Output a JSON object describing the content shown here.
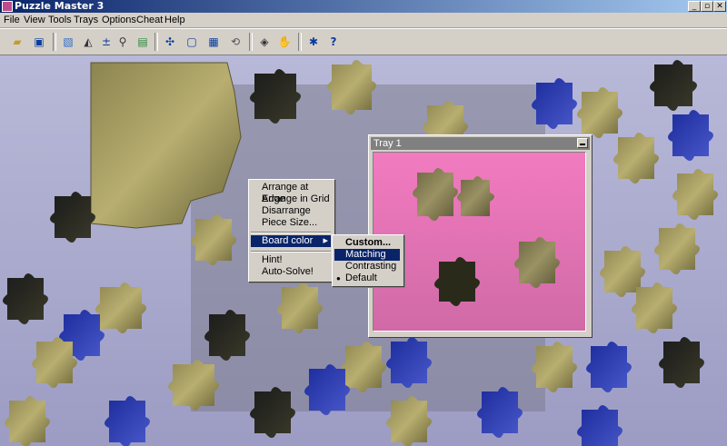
{
  "window": {
    "title": "Puzzle Master 3",
    "minimize_glyph": "_",
    "restore_glyph": "▫",
    "close_glyph": "✕"
  },
  "menubar": [
    "File",
    "View",
    "Tools",
    "Trays",
    "Options",
    "Cheat",
    "Help"
  ],
  "toolbar": {
    "icons": [
      "open-folder-icon",
      "save-icon",
      "picture-icon",
      "mountain-icon",
      "zoom-in-icon",
      "magnifier-icon",
      "palette-icon",
      "shuffle-pieces-icon",
      "edge-pieces-icon",
      "grid-icon",
      "rotate-icon",
      "tray-icon",
      "hand-icon",
      "help-icon",
      "question-icon"
    ]
  },
  "context_menu": {
    "items": [
      "Arrange at Edge",
      "Arrange in Grid",
      "Disarrange",
      "Piece Size...",
      "Board color",
      "Hint!",
      "Auto-Solve!"
    ],
    "submenu_arrow": "▸"
  },
  "board_color_submenu": {
    "items": [
      "Custom...",
      "Matching",
      "Contrasting",
      "Default"
    ],
    "selected_item": "Matching",
    "checked_item": "Default",
    "bullet": "●"
  },
  "tray": {
    "title": "Tray 1"
  },
  "colors": {
    "titlebar_start": "#0a246a",
    "titlebar_end": "#a6caf0",
    "selection": "#0a246a",
    "tray_bg": "#f27bc0",
    "board_bg": "#b8b8d8"
  }
}
